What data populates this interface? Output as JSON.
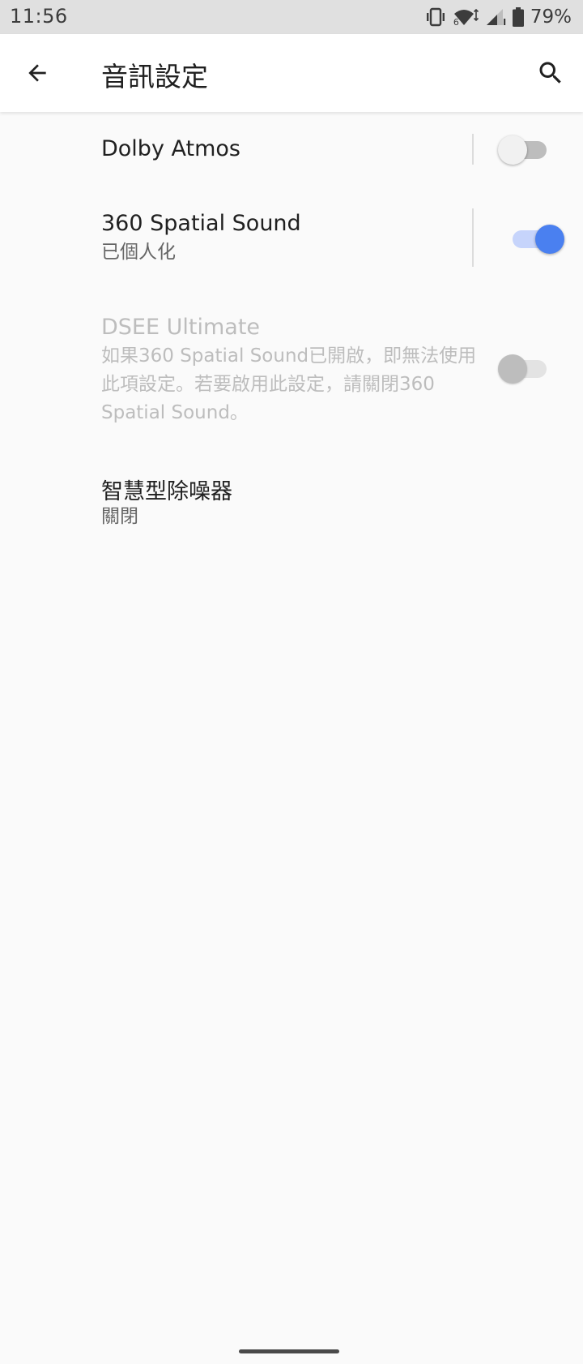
{
  "status_bar": {
    "time": "11:56",
    "network_label": "6",
    "battery_percent": "79%"
  },
  "app_bar": {
    "title": "音訊設定"
  },
  "settings": {
    "dolby": {
      "title": "Dolby Atmos",
      "enabled": false
    },
    "spatial": {
      "title": "360 Spatial Sound",
      "summary": "已個人化",
      "enabled": true
    },
    "dsee": {
      "title": "DSEE Ultimate",
      "summary": "如果360 Spatial Sound已開啟，即無法使用此項設定。若要啟用此設定，請關閉360 Spatial Sound。",
      "enabled": false,
      "disabled": true
    },
    "noise": {
      "title": "智慧型除噪器",
      "summary": "關閉"
    }
  },
  "colors": {
    "accent": "#4a80f0",
    "status_bar_bg": "#e0e0e0",
    "background": "#fafafa"
  },
  "icons": {
    "back": "arrow-back-icon",
    "search": "search-icon",
    "vibrate": "vibrate-icon",
    "wifi": "wifi-icon",
    "signal": "signal-icon",
    "battery": "battery-icon"
  }
}
